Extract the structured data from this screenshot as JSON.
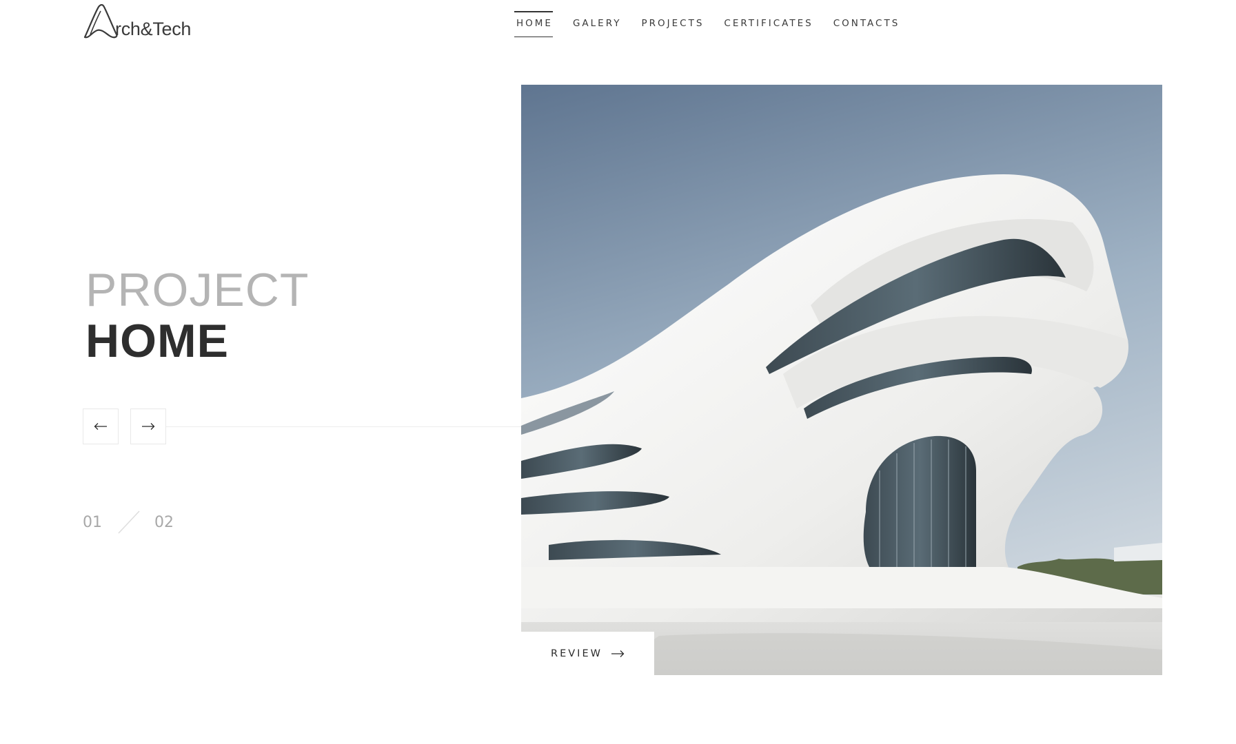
{
  "header": {
    "logo_text": "rch&Tech",
    "logo_mark": "A",
    "nav": [
      {
        "label": "HOME",
        "active": true
      },
      {
        "label": "GALERY",
        "active": false
      },
      {
        "label": "PROJECTS",
        "active": false
      },
      {
        "label": "CERTIFICATES",
        "active": false
      },
      {
        "label": "CONTACTS",
        "active": false
      }
    ]
  },
  "hero": {
    "title_light": "PROJECT",
    "title_bold": "HOME",
    "prev_icon": "arrow-left-icon",
    "next_icon": "arrow-right-icon",
    "counter_current": "01",
    "counter_total": "02",
    "review_label": "REVIEW",
    "review_icon": "arrow-right-icon"
  },
  "colors": {
    "text_dark": "#2e2e2e",
    "text_light": "#b4b4b4",
    "sky_top": "#62778f",
    "sky_bottom": "#b9c6d2",
    "building": "#f2f2f0"
  }
}
